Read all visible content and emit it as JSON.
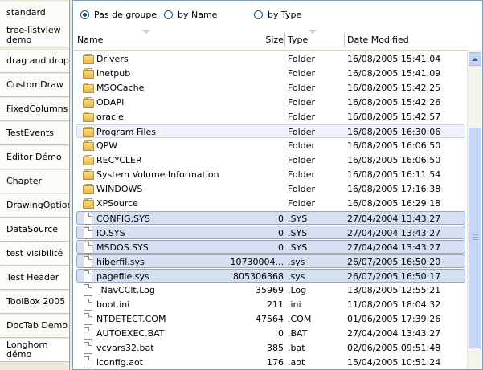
{
  "nav": {
    "items": [
      {
        "label": "standard"
      },
      {
        "label": "tree-listview demo"
      },
      {
        "label": "drag and drop"
      },
      {
        "label": "CustomDraw"
      },
      {
        "label": "FixedColumns"
      },
      {
        "label": "TestEvents"
      },
      {
        "label": "Editor Démo"
      },
      {
        "label": "Chapter"
      },
      {
        "label": "DrawingOption"
      },
      {
        "label": "DataSource"
      },
      {
        "label": "test visibilité"
      },
      {
        "label": "Test Header"
      },
      {
        "label": "ToolBox 2005"
      },
      {
        "label": "DocTab Demo"
      },
      {
        "label": "Longhorn démo"
      }
    ],
    "active_index": 14
  },
  "grouping": {
    "options": [
      {
        "label": "Pas de groupe",
        "checked": true
      },
      {
        "label": "by Name",
        "checked": false
      },
      {
        "label": "by Type",
        "checked": false
      }
    ]
  },
  "list": {
    "columns": {
      "name": "Name",
      "size": "Size",
      "type": "Type",
      "date": "Date Modified"
    },
    "rows": [
      {
        "name": "Drivers",
        "size": "",
        "type": "Folder",
        "date": "16/08/2005 15:41:04",
        "icon": "folder-icon",
        "state": "normal"
      },
      {
        "name": "Inetpub",
        "size": "",
        "type": "Folder",
        "date": "16/08/2005 15:41:09",
        "icon": "folder-icon",
        "state": "normal"
      },
      {
        "name": "MSOCache",
        "size": "",
        "type": "Folder",
        "date": "16/08/2005 15:42:25",
        "icon": "folder-icon",
        "state": "normal"
      },
      {
        "name": "ODAPI",
        "size": "",
        "type": "Folder",
        "date": "16/08/2005 15:42:26",
        "icon": "folder-icon",
        "state": "normal"
      },
      {
        "name": "oracle",
        "size": "",
        "type": "Folder",
        "date": "16/08/2005 15:42:57",
        "icon": "folder-icon",
        "state": "normal"
      },
      {
        "name": "Program Files",
        "size": "",
        "type": "Folder",
        "date": "16/08/2005 16:30:06",
        "icon": "folder-icon",
        "state": "light"
      },
      {
        "name": "QPW",
        "size": "",
        "type": "Folder",
        "date": "16/08/2005 16:06:50",
        "icon": "folder-icon",
        "state": "normal"
      },
      {
        "name": "RECYCLER",
        "size": "",
        "type": "Folder",
        "date": "16/08/2005 16:06:50",
        "icon": "folder-icon",
        "state": "normal"
      },
      {
        "name": "System Volume Information",
        "size": "",
        "type": "Folder",
        "date": "16/08/2005 16:11:54",
        "icon": "folder-icon",
        "state": "normal"
      },
      {
        "name": "WINDOWS",
        "size": "",
        "type": "Folder",
        "date": "16/08/2005 17:16:38",
        "icon": "folder-icon",
        "state": "normal"
      },
      {
        "name": "XPSource",
        "size": "",
        "type": "Folder",
        "date": "16/08/2005 16:29:18",
        "icon": "folder-icon",
        "state": "normal"
      },
      {
        "name": "CONFIG.SYS",
        "size": "0",
        "type": ".SYS",
        "date": "27/04/2004 13:43:27",
        "icon": "file-icon",
        "state": "sel"
      },
      {
        "name": "IO.SYS",
        "size": "0",
        "type": ".SYS",
        "date": "27/04/2004 13:43:27",
        "icon": "file-icon",
        "state": "sel"
      },
      {
        "name": "MSDOS.SYS",
        "size": "0",
        "type": ".SYS",
        "date": "27/04/2004 13:43:27",
        "icon": "file-icon",
        "state": "sel"
      },
      {
        "name": "hiberfil.sys",
        "size": "10730004...",
        "type": ".sys",
        "date": "26/07/2005 16:50:20",
        "icon": "file-icon",
        "state": "sel"
      },
      {
        "name": "pagefile.sys",
        "size": "805306368",
        "type": ".sys",
        "date": "26/07/2005 16:50:17",
        "icon": "file-icon",
        "state": "sel"
      },
      {
        "name": "_NavCClt.Log",
        "size": "35969",
        "type": ".Log",
        "date": "13/08/2005 12:55:21",
        "icon": "file-icon",
        "state": "normal"
      },
      {
        "name": "boot.ini",
        "size": "211",
        "type": ".ini",
        "date": "11/08/2005 18:04:32",
        "icon": "file-icon",
        "state": "normal"
      },
      {
        "name": "NTDETECT.COM",
        "size": "47564",
        "type": ".COM",
        "date": "01/06/2005 17:39:26",
        "icon": "file-icon",
        "state": "normal"
      },
      {
        "name": "AUTOEXEC.BAT",
        "size": "0",
        "type": ".BAT",
        "date": "27/04/2004 13:43:27",
        "icon": "file-icon",
        "state": "normal"
      },
      {
        "name": "vcvars32.bat",
        "size": "385",
        "type": ".bat",
        "date": "02/06/2005 09:51:48",
        "icon": "file-icon",
        "state": "normal"
      },
      {
        "name": "lconfig.aot",
        "size": "176",
        "type": ".aot",
        "date": "15/04/2005 10:51:24",
        "icon": "file-icon",
        "state": "normal"
      }
    ]
  }
}
